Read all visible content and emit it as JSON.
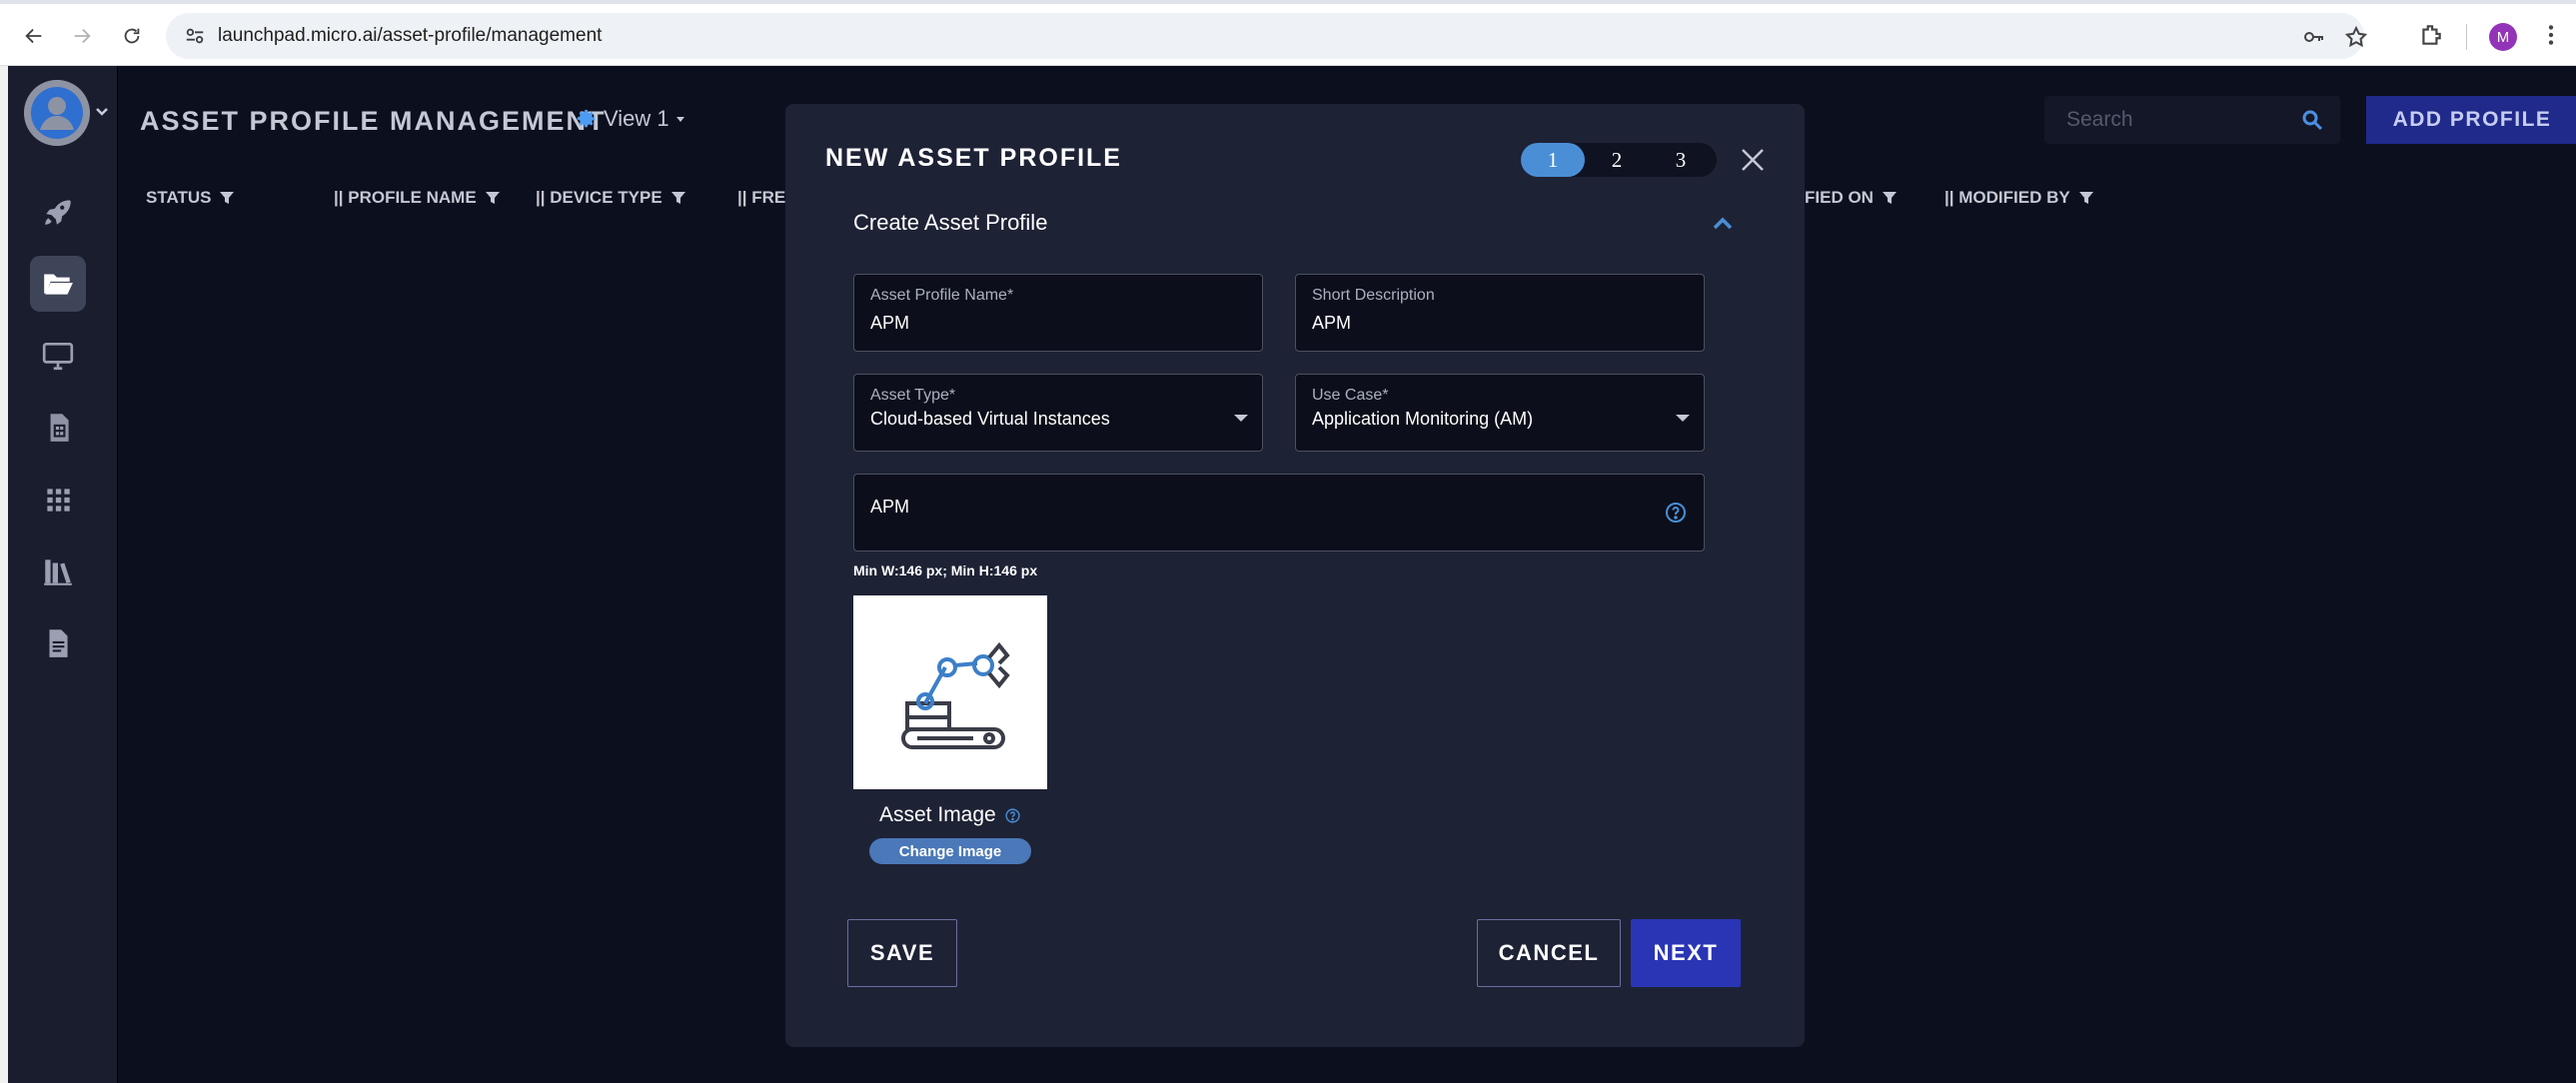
{
  "browser": {
    "url": "launchpad.micro.ai/asset-profile/management",
    "profile_initial": "M"
  },
  "header": {
    "title": "ASSET PROFILE MANAGEMENT",
    "view_label": "View 1",
    "search_placeholder": "Search",
    "add_profile_label": "ADD PROFILE"
  },
  "columns": [
    {
      "label": "STATUS"
    },
    {
      "label": "|| PROFILE NAME"
    },
    {
      "label": "|| DEVICE TYPE"
    },
    {
      "label": "|| FREQ"
    },
    {
      "label": "FIED ON"
    },
    {
      "label": "|| MODIFIED BY"
    }
  ],
  "sidebar": {
    "items": [
      {
        "icon": "rocket-icon"
      },
      {
        "icon": "folder-open-icon",
        "active": true
      },
      {
        "icon": "desktop-icon"
      },
      {
        "icon": "sim-card-icon"
      },
      {
        "icon": "grid-icon"
      },
      {
        "icon": "books-icon"
      },
      {
        "icon": "document-icon"
      }
    ]
  },
  "modal": {
    "title": "NEW ASSET PROFILE",
    "steps": [
      "1",
      "2",
      "3"
    ],
    "active_step": "1",
    "section_title": "Create Asset Profile",
    "fields": {
      "profile_name": {
        "label": "Asset Profile Name*",
        "value": "APM"
      },
      "short_description": {
        "label": "Short Description",
        "value": "APM"
      },
      "asset_type": {
        "label": "Asset Type*",
        "value": "Cloud-based Virtual Instances"
      },
      "use_case": {
        "label": "Use Case*",
        "value": "Application Monitoring (AM)"
      },
      "abbreviation": {
        "value": "APM"
      }
    },
    "min_size_note": "Min W:146 px;   Min H:146 px",
    "asset_image_label": "Asset Image",
    "change_image_label": "Change Image",
    "save_label": "SAVE",
    "cancel_label": "CANCEL",
    "next_label": "NEXT"
  },
  "colors": {
    "accent": "#4a8fd6",
    "primary_button": "#2a35b5",
    "add_profile_button": "#1f2a8a",
    "modal_bg": "#1e2235"
  }
}
